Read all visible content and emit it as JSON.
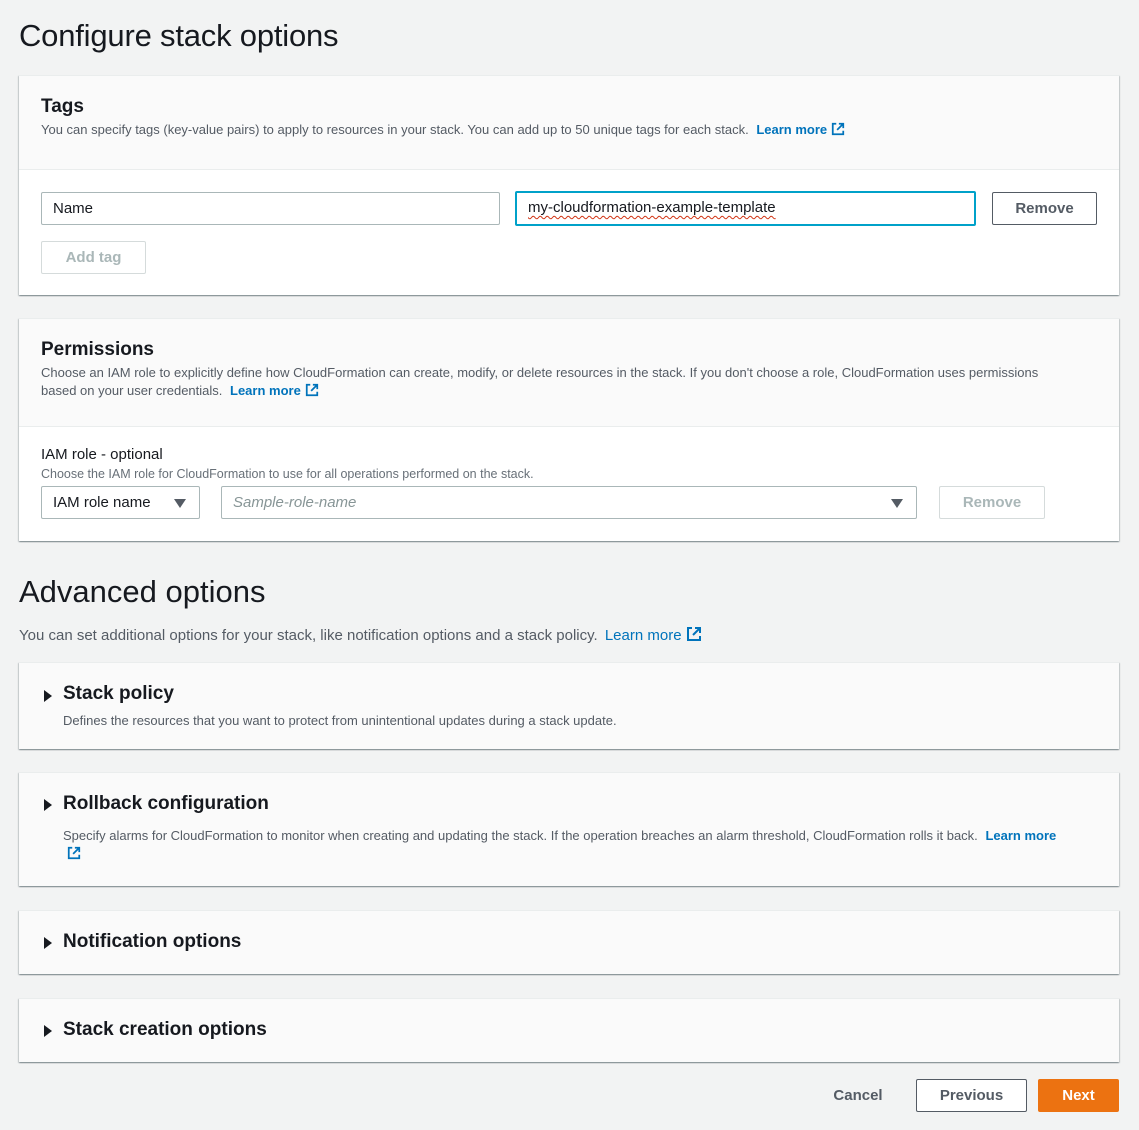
{
  "page": {
    "title": "Configure stack options"
  },
  "tags": {
    "title": "Tags",
    "description": "You can specify tags (key-value pairs) to apply to resources in your stack. You can add up to 50 unique tags for each stack.",
    "learn_more": "Learn more",
    "rows": [
      {
        "key": "Name",
        "value": "my-cloudformation-example-template",
        "remove_label": "Remove"
      }
    ],
    "add_tag_label": "Add tag"
  },
  "permissions": {
    "title": "Permissions",
    "description": "Choose an IAM role to explicitly define how CloudFormation can create, modify, or delete resources in the stack. If you don't choose a role, CloudFormation uses permissions based on your user credentials.",
    "learn_more": "Learn more",
    "iam_role_label": "IAM role - optional",
    "iam_role_description": "Choose the IAM role for CloudFormation to use for all operations performed on the stack.",
    "role_type_selected": "IAM role name",
    "role_name_placeholder": "Sample-role-name",
    "remove_label": "Remove"
  },
  "advanced": {
    "title": "Advanced options",
    "description": "You can set additional options for your stack, like notification options and a stack policy.",
    "learn_more": "Learn more",
    "sections": [
      {
        "title": "Stack policy",
        "description": "Defines the resources that you want to protect from unintentional updates during a stack update.",
        "expanded": false
      },
      {
        "title": "Rollback configuration",
        "description": "Specify alarms for CloudFormation to monitor when creating and updating the stack. If the operation breaches an alarm threshold, CloudFormation rolls it back.",
        "learn_more": "Learn more",
        "expanded": false
      },
      {
        "title": "Notification options",
        "expanded": false
      },
      {
        "title": "Stack creation options",
        "expanded": false
      }
    ]
  },
  "footer": {
    "cancel_label": "Cancel",
    "previous_label": "Previous",
    "next_label": "Next"
  },
  "colors": {
    "accent": "#ec7211",
    "link": "#0073bb",
    "focus": "#00a1c9"
  }
}
